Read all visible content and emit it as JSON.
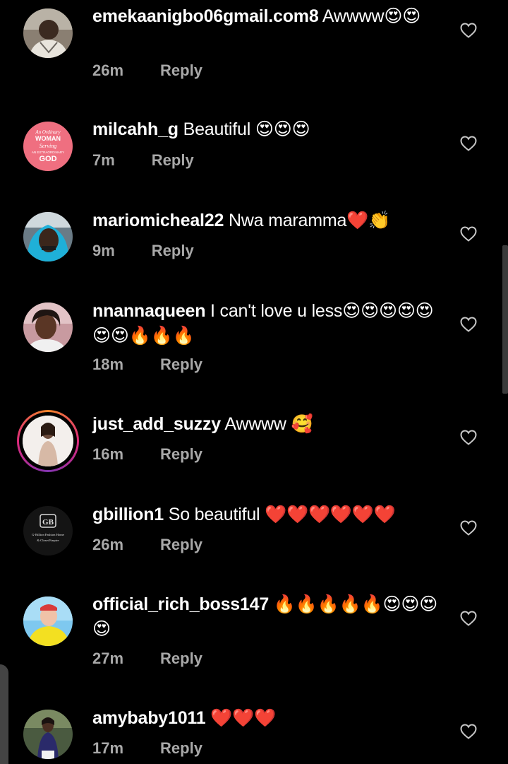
{
  "comments": [
    {
      "username": "emekaanigbo06gmail.com8",
      "text": " Awwww😍😍",
      "time": "26m",
      "reply": "Reply",
      "avatar": "man-avatar-icon"
    },
    {
      "username": "milcahh_g",
      "text": " Beautiful 😍😍😍",
      "time": "7m",
      "reply": "Reply",
      "avatar": "quote-avatar-icon",
      "avatar_text": [
        "An Ordinary",
        "WOMAN",
        "Serving",
        "AN EXTRAORDINARY",
        "GOD"
      ]
    },
    {
      "username": "mariomicheal22",
      "text": " Nwa maramma❤️👏",
      "time": "9m",
      "reply": "Reply",
      "avatar": "hoodie-avatar-icon"
    },
    {
      "username": "nnannaqueen",
      "text": " I can't love u less😍😍😍😍😍😍😍🔥🔥🔥",
      "time": "18m",
      "reply": "Reply",
      "avatar": "woman-avatar-icon"
    },
    {
      "username": "just_add_suzzy",
      "text": " Awwww 🥰",
      "time": "16m",
      "reply": "Reply",
      "avatar": "story-avatar-icon"
    },
    {
      "username": "gbillion1",
      "text": " So beautiful ❤️❤️❤️❤️❤️❤️",
      "time": "26m",
      "reply": "Reply",
      "avatar": "logo-avatar-icon",
      "avatar_text": [
        "GB",
        "G-Billion Fashion Home",
        "& Closet Empire"
      ]
    },
    {
      "username": "official_rich_boss147",
      "text": " 🔥🔥🔥🔥🔥😍😍😍😍",
      "time": "27m",
      "reply": "Reply",
      "avatar": "yellow-shirt-avatar-icon"
    },
    {
      "username": "amybaby1011",
      "text": " ❤️❤️❤️",
      "time": "17m",
      "reply": "Reply",
      "avatar": "lady-avatar-icon"
    }
  ],
  "colors": {
    "background": "#000000",
    "text": "#ffffff",
    "meta": "#a8a8a8",
    "heart_outline": "#c8c8c8"
  },
  "icons": {
    "like": "heart-outline-icon"
  }
}
